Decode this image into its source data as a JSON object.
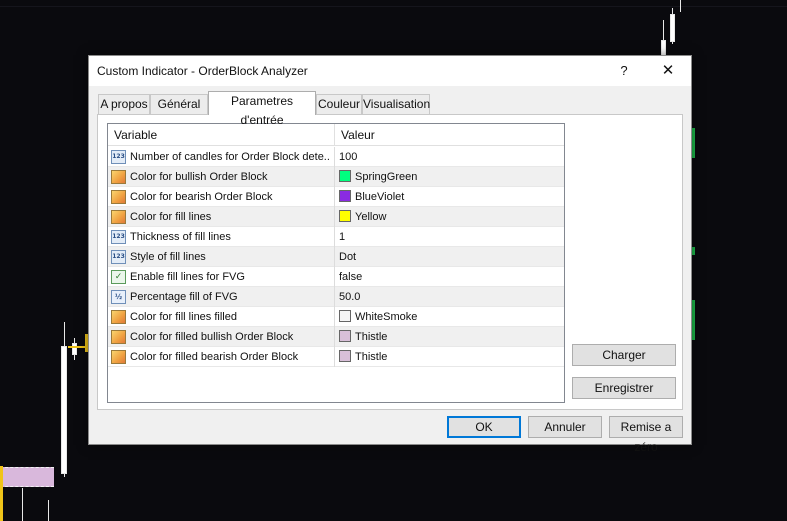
{
  "dialog": {
    "title": "Custom Indicator - OrderBlock Analyzer",
    "help": "?",
    "close": "✕"
  },
  "tabs": [
    {
      "label": "A propos"
    },
    {
      "label": "Général"
    },
    {
      "label": "Parametres d'entrée",
      "active": true
    },
    {
      "label": "Couleur"
    },
    {
      "label": "Visualisation"
    }
  ],
  "grid": {
    "headers": {
      "variable": "Variable",
      "valeur": "Valeur"
    },
    "rows": [
      {
        "icon": "numeric-icon",
        "name": "Number of candles for Order Block dete...",
        "value": "100"
      },
      {
        "icon": "color-icon",
        "name": "Color for bullish Order Block",
        "value": "SpringGreen",
        "color": "#00ff7f"
      },
      {
        "icon": "color-icon",
        "name": "Color for bearish Order Block",
        "value": "BlueViolet",
        "color": "#8a2be2"
      },
      {
        "icon": "color-icon",
        "name": "Color for fill lines",
        "value": "Yellow",
        "color": "#ffff00"
      },
      {
        "icon": "numeric-icon",
        "name": "Thickness of fill lines",
        "value": "1"
      },
      {
        "icon": "numeric-icon",
        "name": "Style of fill lines",
        "value": "Dot"
      },
      {
        "icon": "boolean-icon",
        "name": "Enable fill lines for FVG",
        "value": "false"
      },
      {
        "icon": "fraction-icon",
        "name": "Percentage fill of FVG",
        "value": "50.0"
      },
      {
        "icon": "color-icon",
        "name": "Color for fill lines filled",
        "value": "WhiteSmoke",
        "color": "#f5f5f5"
      },
      {
        "icon": "color-icon",
        "name": "Color for filled bullish Order Block",
        "value": "Thistle",
        "color": "#d8bfd8"
      },
      {
        "icon": "color-icon",
        "name": "Color for filled bearish Order Block",
        "value": "Thistle",
        "color": "#d8bfd8"
      }
    ]
  },
  "side_buttons": {
    "load": "Charger",
    "save": "Enregistrer"
  },
  "buttons": {
    "ok": "OK",
    "cancel": "Annuler",
    "reset": "Remise a zéro"
  }
}
